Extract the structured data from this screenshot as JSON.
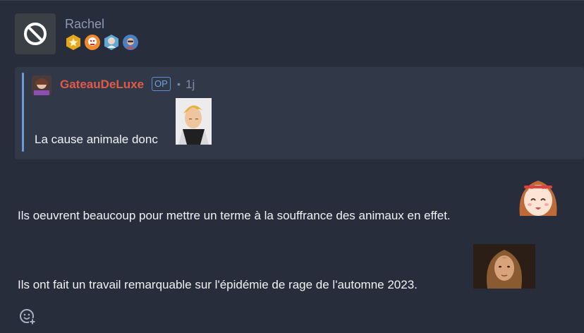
{
  "post": {
    "author": "Rachel",
    "avatar_icon": "blocked-icon",
    "badges": [
      "star-badge",
      "robot-badge",
      "avatar-badge",
      "avatar-badge"
    ]
  },
  "quote": {
    "author": "GateauDeLuxe",
    "op_tag": "OP",
    "separator": "•",
    "age": "1j",
    "text": "La cause animale donc"
  },
  "body": {
    "line1": "Ils oeuvrent beaucoup pour mettre un terme à la souffrance des animaux en effet.",
    "line2": "Ils ont fait un travail remarquable sur l'épidémie de rage de l'automne 2023."
  },
  "colors": {
    "background": "#272d3a",
    "quote_bg": "#313949",
    "quote_bar": "#6a9bd3",
    "author_red": "#e05a4a",
    "op_blue": "#6fa3e0",
    "username_gray": "#8c99b3"
  }
}
